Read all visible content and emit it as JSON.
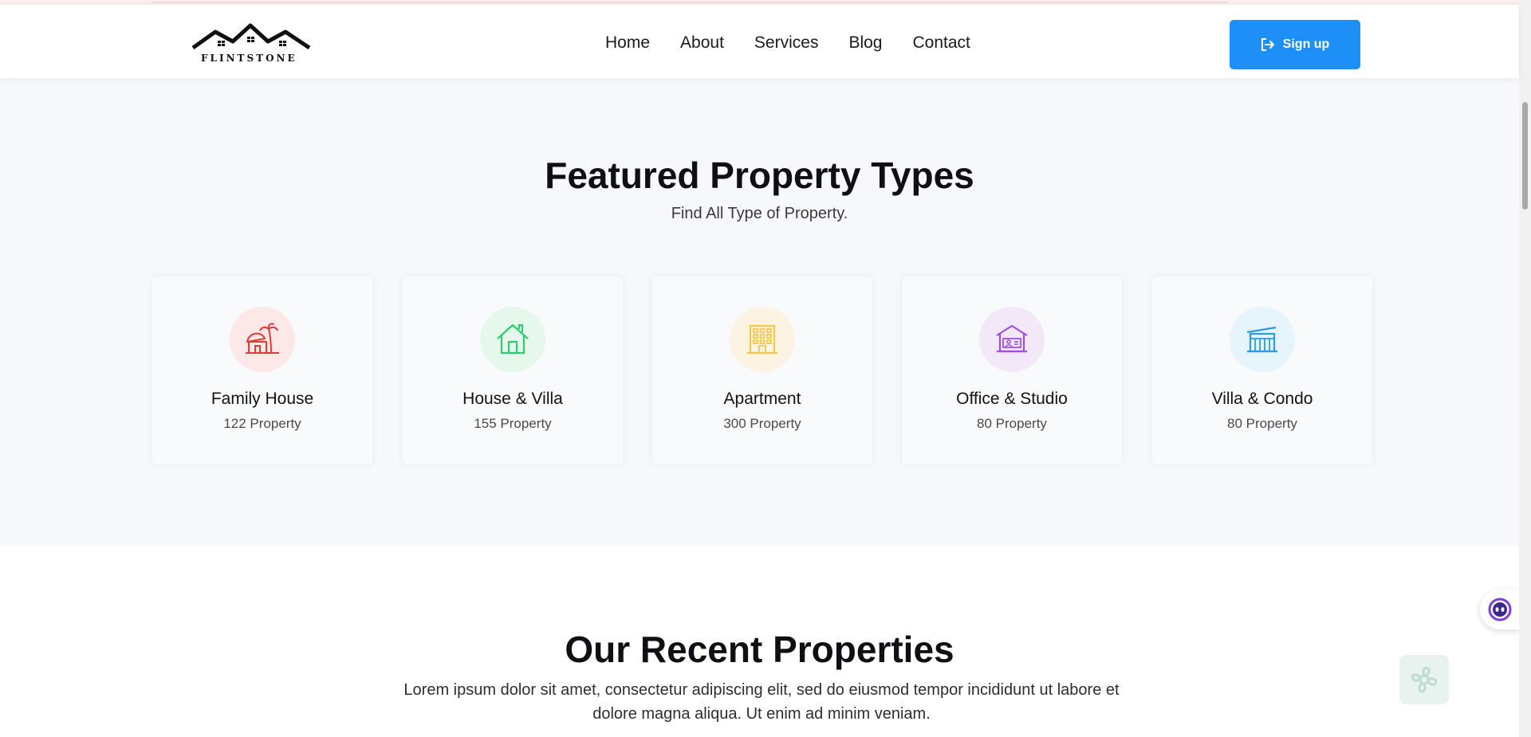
{
  "header": {
    "logo_text": "FLINTSTONE",
    "nav": [
      "Home",
      "About",
      "Services",
      "Blog",
      "Contact"
    ],
    "signup_label": "Sign up",
    "accent_color": "#1e8ff6"
  },
  "featured": {
    "title": "Featured Property Types",
    "subtitle": "Find All Type of Property.",
    "cards": [
      {
        "title": "Family House",
        "count": "122 Property",
        "icon": "beach-house-icon",
        "icon_color": "#e53935",
        "bg_color": "#fde8e8"
      },
      {
        "title": "House & Villa",
        "count": "155 Property",
        "icon": "house-icon",
        "icon_color": "#2ecc71",
        "bg_color": "#e6f7ec"
      },
      {
        "title": "Apartment",
        "count": "300 Property",
        "icon": "apartment-building-icon",
        "icon_color": "#f2c94c",
        "bg_color": "#fdf3e3"
      },
      {
        "title": "Office & Studio",
        "count": "80 Property",
        "icon": "office-icon",
        "icon_color": "#9b51e0",
        "bg_color": "#f3e8f8"
      },
      {
        "title": "Villa & Condo",
        "count": "80 Property",
        "icon": "condo-icon",
        "icon_color": "#2d9cdb",
        "bg_color": "#e6f4fb"
      }
    ]
  },
  "recent": {
    "title": "Our Recent Properties",
    "description": "Lorem ipsum dolor sit amet, consectetur adipiscing elit, sed do eiusmod tempor incididunt ut labore et dolore magna aliqua. Ut enim ad minim veniam."
  }
}
